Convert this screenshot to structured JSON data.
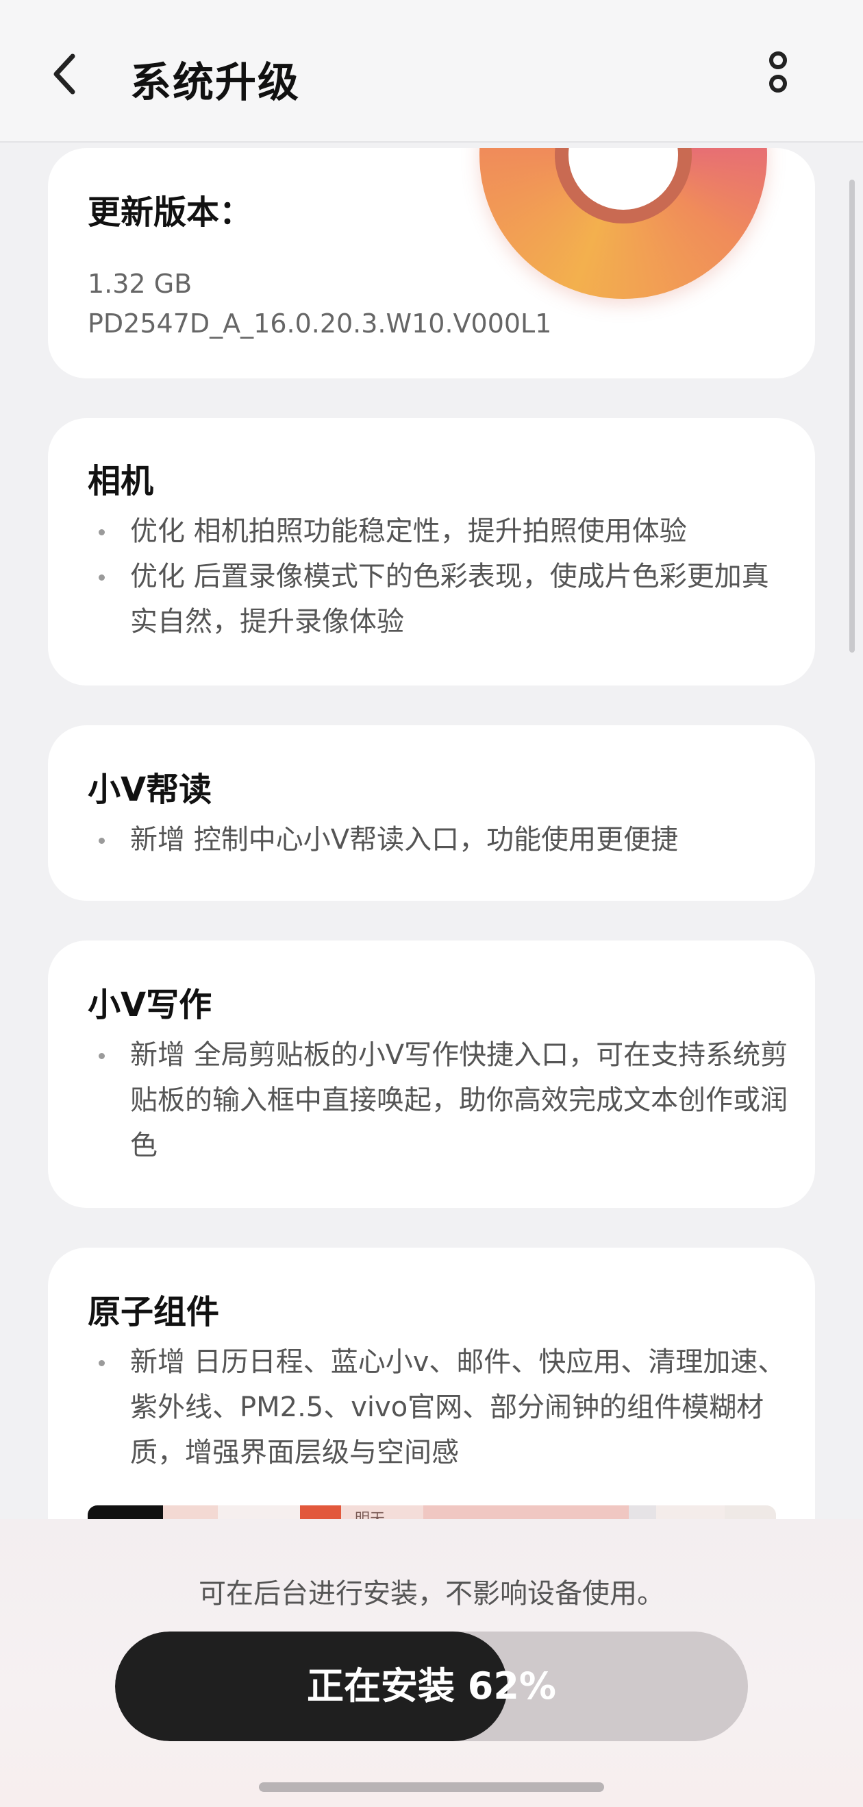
{
  "header": {
    "title": "系统升级",
    "back_icon": "chevron-left-icon",
    "more_icon": "more-vertical-icon"
  },
  "version_card": {
    "heading": "更新版本：",
    "size": "1.32 GB",
    "version": "PD2547D_A_16.0.20.3.W10.V000L1"
  },
  "sections": [
    {
      "title": "相机",
      "items": [
        "优化 相机拍照功能稳定性，提升拍照使用体验",
        "优化 后置录像模式下的色彩表现，使成片色彩更加真实自然，提升录像体验"
      ]
    },
    {
      "title": "小V帮读",
      "items": [
        "新增 控制中心小V帮读入口，功能使用更便捷"
      ]
    },
    {
      "title": "小V写作",
      "items": [
        "新增 全局剪贴板的小V写作快捷入口，可在支持系统剪贴板的输入框中直接唤起，助你高效完成文本创作或润色"
      ]
    },
    {
      "title": "原子组件",
      "items": [
        "新增 日历日程、蓝心小v、邮件、快应用、清理加速、紫外线、PM2.5、vivo官网、部分闹钟的组件模糊材质，增强界面层级与空间感"
      ]
    }
  ],
  "preview_text": "明天",
  "bottom": {
    "hint": "可在后台进行安装，不影响设备使用。",
    "progress_label": "正在安装 62%",
    "progress_fraction": 0.62
  },
  "colors": {
    "background": "#f1f1f3",
    "card": "#ffffff",
    "progress_fill": "#1f1f1f",
    "progress_track": "#cfc9cb"
  }
}
